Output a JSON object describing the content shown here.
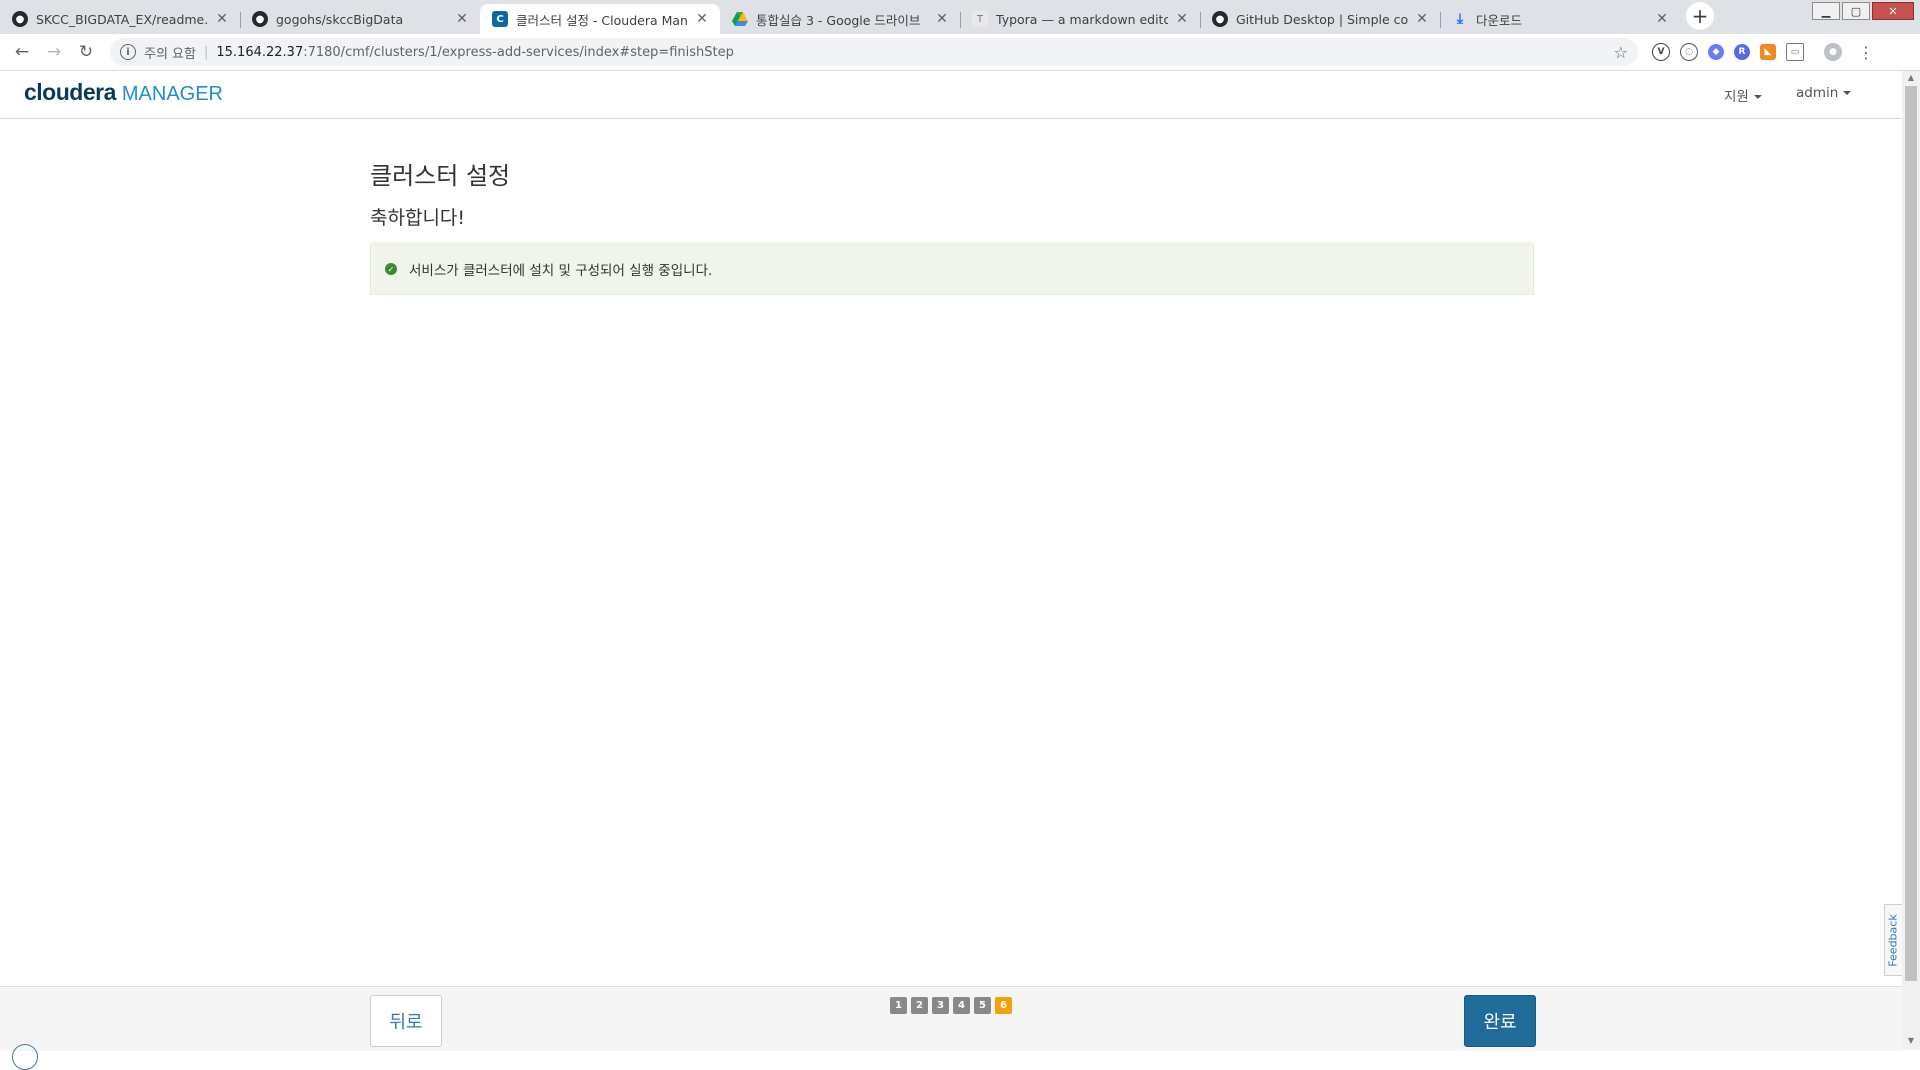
{
  "browser": {
    "tabs": [
      {
        "title": "SKCC_BIGDATA_EX/readme.md a",
        "favicon": "github-icon",
        "active": false
      },
      {
        "title": "gogohs/skccBigData",
        "favicon": "github-icon",
        "active": false
      },
      {
        "title": "클러스터 설정 - Cloudera Mana",
        "favicon": "cloudera-icon",
        "active": true
      },
      {
        "title": "통합실습 3 - Google 드라이브",
        "favicon": "google-drive-icon",
        "active": false
      },
      {
        "title": "Typora — a markdown editor, m",
        "favicon": "typora-icon",
        "active": false
      },
      {
        "title": "GitHub Desktop | Simple collab",
        "favicon": "github-icon",
        "active": false
      },
      {
        "title": "다운로드",
        "favicon": "download-icon",
        "active": false
      }
    ],
    "security_label": "주의 요함",
    "url_host": "15.164.22.37",
    "url_rest": ":7180/cmf/clusters/1/express-add-services/index#step=finishStep"
  },
  "header": {
    "logo_main": "cloudera",
    "logo_sub": "MANAGER",
    "support_menu": "지원",
    "user_menu": "admin"
  },
  "main": {
    "title": "클러스터 설정",
    "subtitle": "축하합니다!",
    "success_message": "서비스가 클러스터에 설치 및 구성되어 실행 중입니다."
  },
  "feedback_label": "Feedback",
  "footer": {
    "back_label": "뒤로",
    "finish_label": "완료",
    "steps": [
      "1",
      "2",
      "3",
      "4",
      "5",
      "6"
    ],
    "current_step": 6
  },
  "colors": {
    "accent": "#1f6b99",
    "current_step": "#f0a30a",
    "success_bg": "#eff5eb",
    "success_icon": "#3c8a2e"
  }
}
